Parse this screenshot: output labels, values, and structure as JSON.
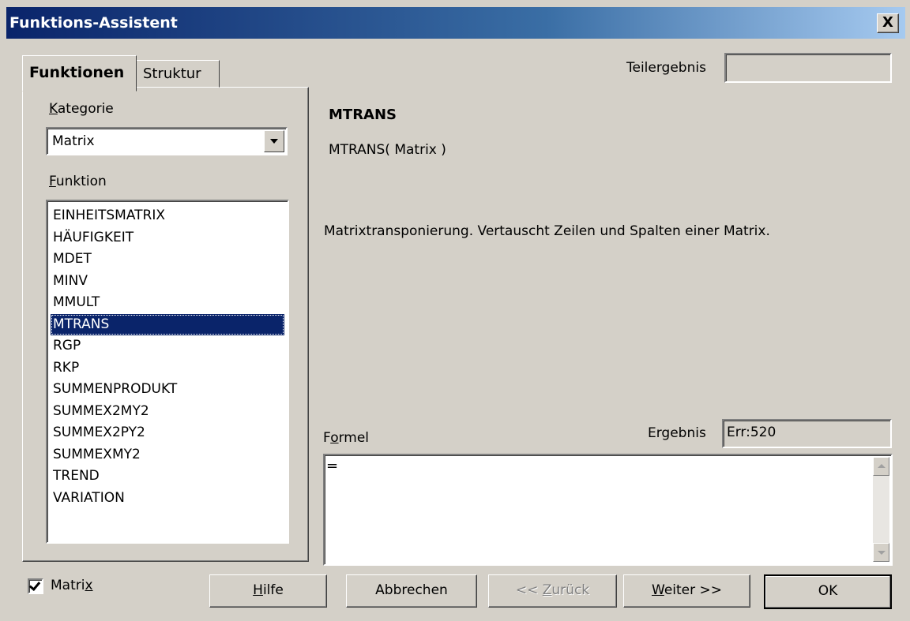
{
  "window": {
    "title": "Funktions-Assistent",
    "close_label": "X"
  },
  "tabs": {
    "funktionen": "Funktionen",
    "struktur": "Struktur"
  },
  "left": {
    "kategorie_label_first": "K",
    "kategorie_label_rest": "ategorie",
    "kategorie_value": "Matrix",
    "funktion_label_first": "F",
    "funktion_label_rest": "unktion",
    "functions": [
      "EINHEITSMATRIX",
      "HÄUFIGKEIT",
      "MDET",
      "MINV",
      "MMULT",
      "MTRANS",
      "RGP",
      "RKP",
      "SUMMENPRODUKT",
      "SUMMEX2MY2",
      "SUMMEX2PY2",
      "SUMMEXMY2",
      "TREND",
      "VARIATION"
    ],
    "selected_function": "MTRANS"
  },
  "right": {
    "teilergebnis_label": "Teilergebnis",
    "teilergebnis_value": "",
    "function_name": "MTRANS",
    "function_syntax": "MTRANS( Matrix )",
    "function_description": "Matrixtransponierung. Vertauscht Zeilen und Spalten einer Matrix.",
    "formel_label_first": "F",
    "formel_label_u": "o",
    "formel_label_rest": "rmel",
    "ergebnis_label": "Ergebnis",
    "ergebnis_value": "Err:520",
    "formula_value": "="
  },
  "bottom": {
    "matrix_checkbox_label_main": "Matri",
    "matrix_checkbox_label_u": "x",
    "matrix_checked": true,
    "hilfe_u": "H",
    "hilfe_rest": "ilfe",
    "abbrechen": "Abbrechen",
    "zurueck_prefix": "<< ",
    "zurueck_u": "Z",
    "zurueck_rest": "urück",
    "weiter_u": "W",
    "weiter_rest": "eiter >>",
    "ok": "OK"
  }
}
